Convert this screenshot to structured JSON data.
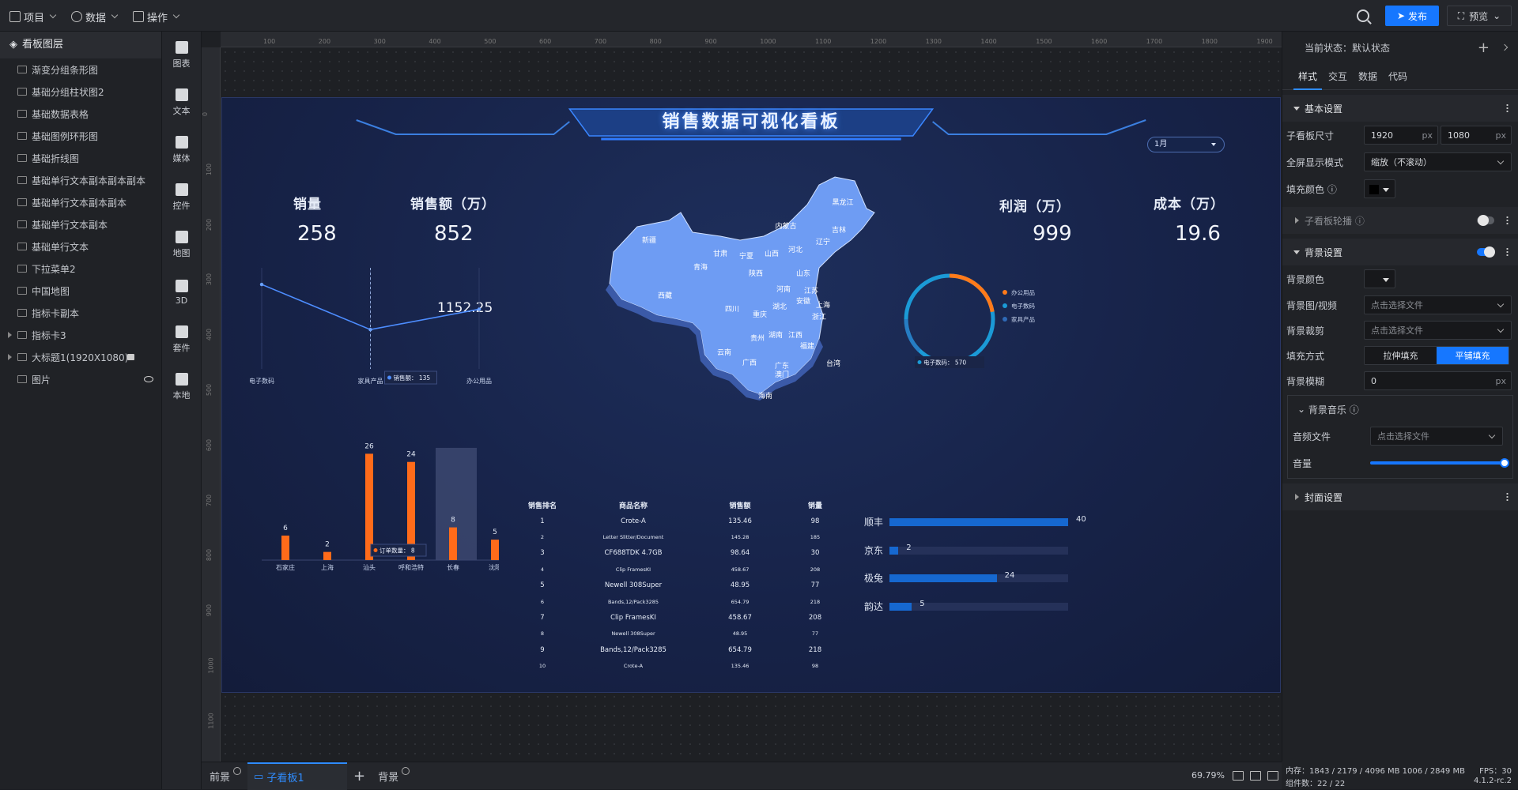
{
  "topbar": {
    "menus": [
      "项目",
      "数据",
      "操作"
    ],
    "publish_label": "发布",
    "preview_label": "预览"
  },
  "layers": {
    "title": "看板图层",
    "items": [
      "渐变分组条形图",
      "基础分组柱状图2",
      "基础数据表格",
      "基础图例环形图",
      "基础折线图",
      "基础单行文本副本副本副本",
      "基础单行文本副本副本",
      "基础单行文本副本",
      "基础单行文本",
      "下拉菜单2",
      "中国地图",
      "指标卡副本",
      "指标卡3",
      "大标题1(1920X1080)",
      "图片"
    ]
  },
  "toolbar": {
    "tools": [
      "图表",
      "文本",
      "媒体",
      "控件",
      "地图",
      "3D",
      "套件",
      "本地"
    ]
  },
  "ruler": {
    "h_ticks": [
      "100",
      "200",
      "300",
      "400",
      "500",
      "600",
      "700",
      "800",
      "900",
      "1000",
      "1100",
      "1200",
      "1300",
      "1400",
      "1500",
      "1600",
      "1700",
      "1800",
      "1900"
    ],
    "v_ticks": [
      "0",
      "100",
      "200",
      "300",
      "400",
      "500",
      "600",
      "700",
      "800",
      "900",
      "1000",
      "1100"
    ]
  },
  "dashboard": {
    "title": "销售数据可视化看板",
    "month_select": "1月",
    "kpis": [
      {
        "label": "销量",
        "value": "258"
      },
      {
        "label": "销售额（万）",
        "value": "852"
      },
      {
        "label": "利润（万）",
        "value": "999"
      },
      {
        "label": "成本（万）",
        "value": "19.6"
      }
    ],
    "line_top_value": "1152.25",
    "map_provinces": [
      "新疆",
      "西藏",
      "青海",
      "甘肃",
      "内蒙古",
      "黑龙江",
      "吉林",
      "辽宁",
      "宁夏",
      "山西",
      "河北",
      "陕西",
      "山东",
      "河南",
      "四川",
      "重庆",
      "湖北",
      "安徽",
      "江苏",
      "上海",
      "浙江",
      "贵州",
      "湖南",
      "江西",
      "福建",
      "云南",
      "广西",
      "广东",
      "澳门",
      "台湾",
      "海南"
    ]
  },
  "chart_data": [
    {
      "type": "line",
      "title": "",
      "categories": [
        "电子数码",
        "家具产品",
        "办公用品"
      ],
      "series": [
        {
          "values": [
            290,
            135,
            205
          ]
        }
      ],
      "tooltip": {
        "label": "销售额：",
        "value": "135"
      }
    },
    {
      "type": "bar",
      "title": "",
      "categories": [
        "石家庄",
        "上海",
        "汕头",
        "呼和浩特",
        "长春",
        "沈阳"
      ],
      "values": [
        6,
        2,
        26,
        24,
        8,
        5
      ],
      "colors": [
        "#ff6b1a"
      ],
      "tooltip": {
        "label": "订单数量：",
        "value": "8"
      }
    },
    {
      "type": "pie",
      "title": "",
      "legend": [
        "办公用品",
        "电子数码",
        "家具产品"
      ],
      "colors": [
        "#ff7a1a",
        "#1b9ad6",
        "#2f6ab7"
      ],
      "values": [
        30,
        570,
        0
      ],
      "tooltip": {
        "label": "电子数码：",
        "value": "570"
      }
    },
    {
      "type": "table",
      "columns": [
        "销售排名",
        "商品名称",
        "销售额",
        "销量"
      ],
      "rows": [
        [
          "1",
          "Crote-A",
          "135.46",
          "98"
        ],
        [
          "2",
          "Letter Slitter/Document",
          "145.28",
          "185"
        ],
        [
          "3",
          "CF688TDK 4.7GB",
          "98.64",
          "30"
        ],
        [
          "4",
          "Clip FramesKI",
          "458.67",
          "208"
        ],
        [
          "5",
          "Newell 308Super",
          "48.95",
          "77"
        ],
        [
          "6",
          "Bands,12/Pack3285",
          "654.79",
          "218"
        ],
        [
          "7",
          "Clip FramesKI",
          "458.67",
          "208"
        ],
        [
          "8",
          "Newell 308Super",
          "48.95",
          "77"
        ],
        [
          "9",
          "Bands,12/Pack3285",
          "654.79",
          "218"
        ],
        [
          "10",
          "Crote-A",
          "135.46",
          "98"
        ]
      ]
    },
    {
      "type": "bar",
      "orientation": "horizontal",
      "categories": [
        "顺丰",
        "京东",
        "极兔",
        "韵达"
      ],
      "values": [
        40,
        2,
        24,
        5
      ],
      "xlim": [
        0,
        40
      ]
    }
  ],
  "bottom": {
    "tabs": [
      "前景",
      "子看板1",
      "背景"
    ],
    "zoom": "69.79%"
  },
  "props": {
    "state_label": "当前状态：默认状态",
    "tabs": [
      "样式",
      "交互",
      "数据",
      "代码"
    ],
    "basic_section": "基本设置",
    "size_label": "子看板尺寸",
    "width": "1920",
    "height": "1080",
    "unit": "px",
    "fullscreen_label": "全屏显示模式",
    "fullscreen_value": "缩放（不滚动）",
    "fill_color_label": "填充颜色",
    "carousel_section": "子看板轮播",
    "bg_section": "背景设置",
    "bg_color_label": "背景颜色",
    "bg_image_label": "背景图/视频",
    "bg_crop_label": "背景裁剪",
    "choose_file": "点击选择文件",
    "fill_mode_label": "填充方式",
    "fill_modes": [
      "拉伸填充",
      "平铺填充"
    ],
    "bg_blur_label": "背景模糊",
    "bg_blur_value": "0",
    "bg_music_section": "背景音乐",
    "audio_file_label": "音频文件",
    "volume_label": "音量",
    "volume_level": 1.0,
    "cover_section": "封面设置"
  },
  "status": {
    "memory": "内存：1843 / 2179 / 4096 MB 1006 / 2849 MB",
    "fps": "FPS：30",
    "components": "组件数：22 / 22",
    "version": "4.1.2-rc.2"
  }
}
